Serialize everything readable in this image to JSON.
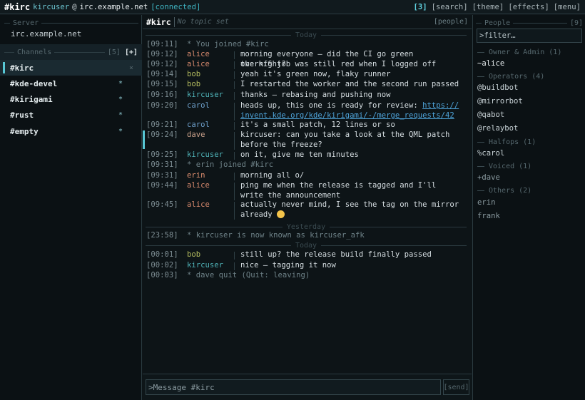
{
  "topbar": {
    "app": "#kirc",
    "nick": "kircuser",
    "at": "@",
    "host": "irc.example.net",
    "status": "[connected]",
    "count": "[3]",
    "search": "[search]",
    "theme": "[theme]",
    "effects": "[effects]",
    "menu": "[menu]"
  },
  "sidebar": {
    "server_header": "Server",
    "server_name": "irc.example.net",
    "channels_header": "Channels",
    "channels_count": "[5]",
    "add_label": "[+]",
    "channels": [
      {
        "name": "#kirc",
        "mark": "×"
      },
      {
        "name": "#kde-devel",
        "mark": "*"
      },
      {
        "name": "#kirigami",
        "mark": "*"
      },
      {
        "name": "#rust",
        "mark": "*"
      },
      {
        "name": "#empty",
        "mark": "*"
      }
    ]
  },
  "chanbar": {
    "name": "#kirc",
    "topic": "No topic set",
    "people_button": "[people]"
  },
  "days": {
    "today1": "Today",
    "yesterday": "Yesterday",
    "today2": "Today"
  },
  "messages": [
    {
      "ts": "[09:11]",
      "event": "* You joined #kirc"
    },
    {
      "ts": "[09:12]",
      "nick": "alice",
      "text": "morning everyone — did the CI go green overnight?"
    },
    {
      "ts": "[09:12]",
      "nick": "alice",
      "text": "the kf6 job was still red when I logged off"
    },
    {
      "ts": "[09:14]",
      "nick": "bob",
      "text": "yeah it's green now, flaky runner"
    },
    {
      "ts": "[09:15]",
      "nick": "bob",
      "text": "I restarted the worker and the second run passed"
    },
    {
      "ts": "[09:16]",
      "nick": "kircuser",
      "text": "thanks — rebasing and pushing now"
    },
    {
      "ts": "[09:20]",
      "nick": "carol",
      "text": "heads up, this one is ready for review:",
      "link": "https://invent.kde.org/kde/kirigami/-/merge_requests/42"
    },
    {
      "ts": "[09:21]",
      "nick": "carol",
      "text": "it's a small patch, 12 lines or so"
    },
    {
      "ts": "[09:24]",
      "nick": "dave",
      "text": "kircuser: can you take a look at the QML patch before the freeze?"
    },
    {
      "ts": "[09:25]",
      "nick": "kircuser",
      "text": "on it, give me ten minutes"
    },
    {
      "ts": "[09:31]",
      "event": "* erin joined #kirc"
    },
    {
      "ts": "[09:31]",
      "nick": "erin",
      "text": "morning all o/"
    },
    {
      "ts": "[09:44]",
      "nick": "alice",
      "text": "ping me when the release is tagged and I'll write the announcement"
    },
    {
      "ts": "[09:45]",
      "nick": "alice",
      "text": "actually never mind, I see the tag on the mirror already"
    },
    {
      "ts": "[23:58]",
      "event": "* kircuser is now known as kircuser_afk"
    },
    {
      "ts": "[00:01]",
      "nick": "bob",
      "text": "still up? the release build finally passed"
    },
    {
      "ts": "[00:02]",
      "nick": "kircuser",
      "text": "nice — tagging it now"
    },
    {
      "ts": "[00:03]",
      "event": "* dave quit (Quit: leaving)"
    }
  ],
  "input": {
    "prompt": ">",
    "placeholder": "Message #kirc",
    "send_label": "[send]"
  },
  "people": {
    "header": "People",
    "count": "[9]",
    "filter_placeholder": ">filter…",
    "groups": [
      {
        "label": "Owner & Admin (1)",
        "users": [
          "~alice"
        ]
      },
      {
        "label": "Operators (4)",
        "users": [
          "@buildbot",
          "@mirrorbot",
          "@qabot",
          "@relaybot"
        ]
      },
      {
        "label": "Halfops (1)",
        "users": [
          "%carol"
        ]
      },
      {
        "label": "Voiced (1)",
        "users": [
          "+dave"
        ]
      },
      {
        "label": "Others (2)",
        "users": [
          "erin",
          "frank"
        ]
      }
    ]
  },
  "colors": {
    "accent": "#58c8d6",
    "background": "#0e1518",
    "link": "#4ea3d9"
  }
}
